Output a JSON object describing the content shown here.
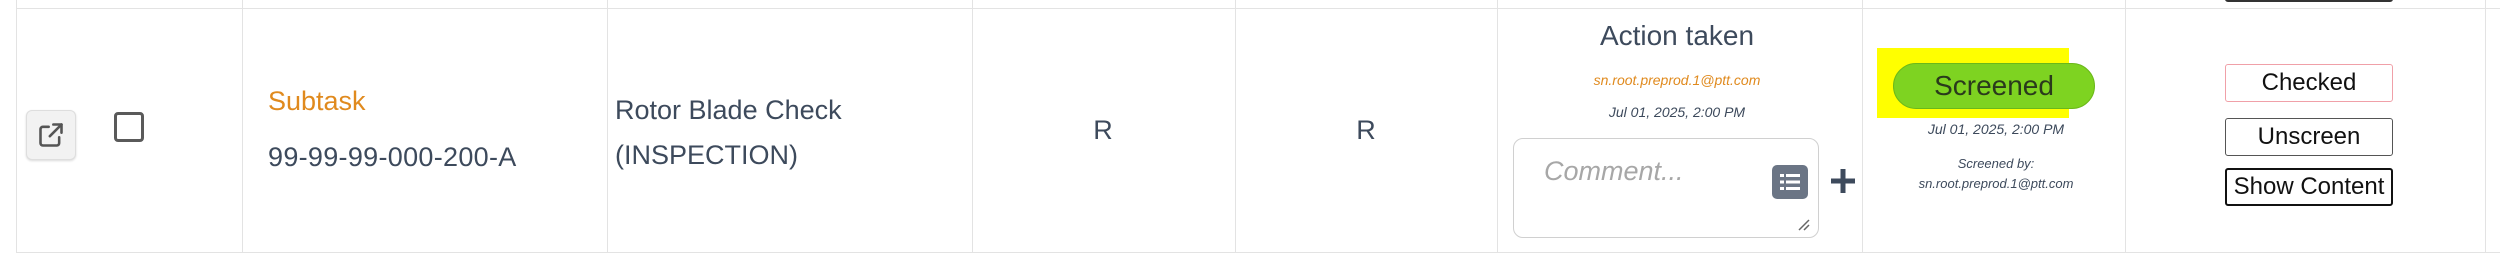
{
  "row": {
    "subtask_type": "Subtask",
    "subtask_id": "99-99-99-000-200-A",
    "description_line1": "Rotor Blade Check",
    "description_line2": "(INSPECTION)",
    "col_r1": "R",
    "col_r2": "R"
  },
  "action": {
    "title": "Action taken",
    "user": "sn.root.preprod.1@ptt.com",
    "date": "Jul 01, 2025, 2:00 PM",
    "comment_placeholder": "Comment...",
    "comment_value": ""
  },
  "screening": {
    "status": "Screened",
    "date": "Jul 01, 2025, 2:00 PM",
    "by_label": "Screened by:",
    "by_user": "sn.root.preprod.1@ptt.com",
    "status_color": "#7ed321",
    "highlight_color": "#ffff00"
  },
  "buttons": {
    "checked": "Checked",
    "unscreen": "Unscreen",
    "show_content": "Show Content"
  },
  "icons": {
    "open": "external-link-icon",
    "list": "list-icon",
    "add": "plus-icon",
    "resize": "resize-handle-icon"
  },
  "colors": {
    "accent_orange": "#e08a1e",
    "text": "#3d4a5c"
  }
}
